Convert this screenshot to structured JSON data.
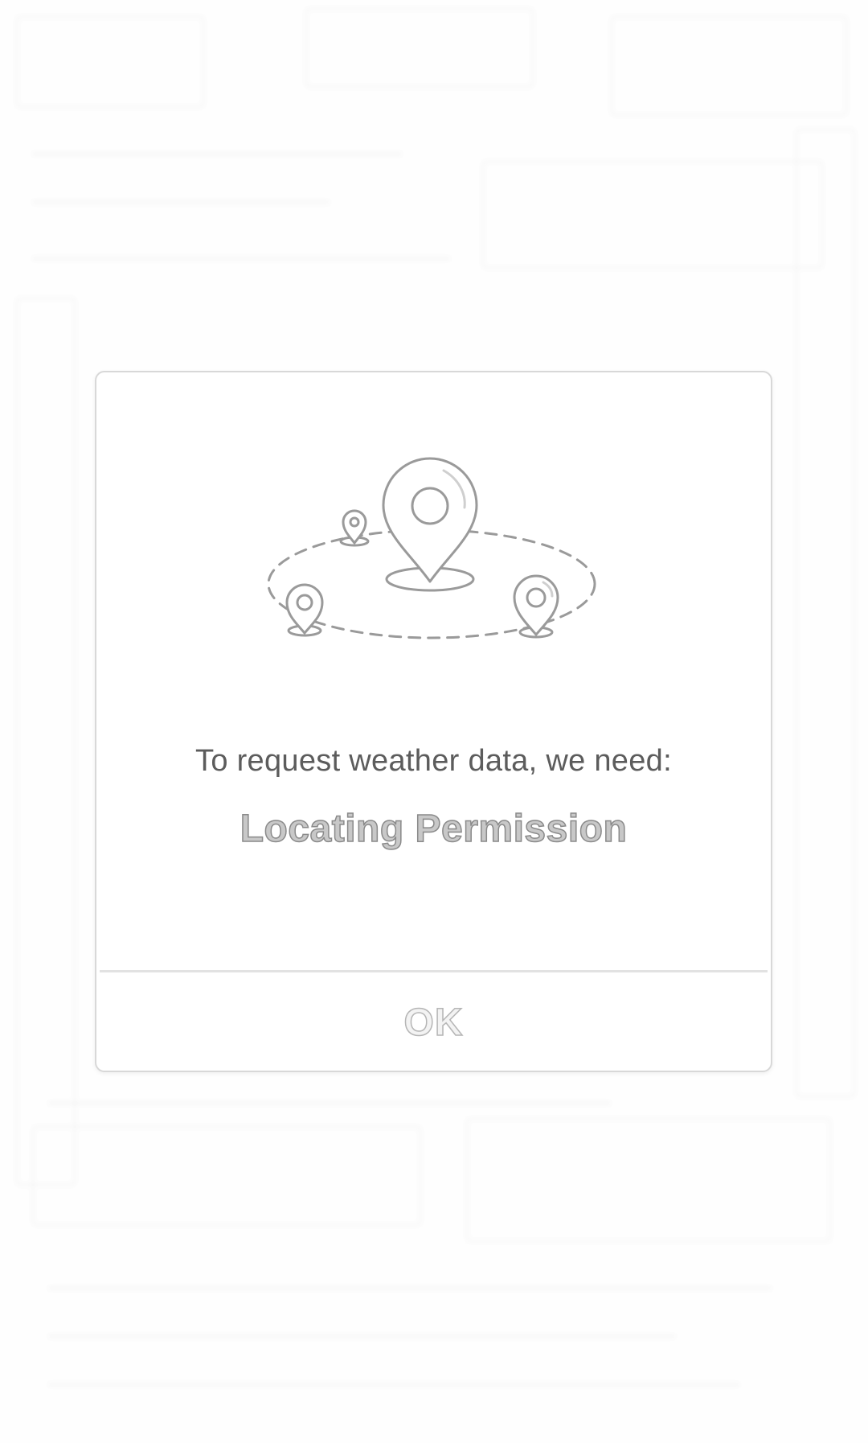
{
  "dialog": {
    "illustration_icon": "location-pins-map-icon",
    "message": "To request weather data, we need:",
    "permission_name": "Locating Permission",
    "ok_label": "OK"
  },
  "colors": {
    "message_text": "#5c5c5c",
    "permission_text": "#8a8a8a",
    "ok_text": "#b5b5b5",
    "dialog_border": "#d8d8d8"
  }
}
